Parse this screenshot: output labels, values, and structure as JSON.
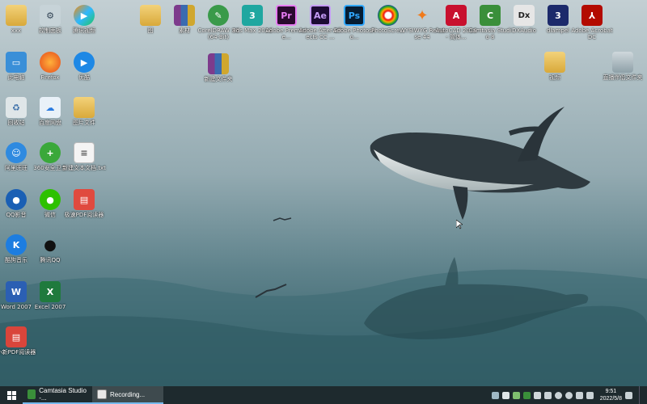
{
  "desktop_icons": {
    "left_col1": [
      {
        "label": "xxx"
      },
      {
        "label": "此电脑"
      },
      {
        "label": "回收站"
      },
      {
        "label": "阿里旺旺"
      },
      {
        "label": "QQ影音"
      },
      {
        "label": "酷狗音乐"
      },
      {
        "label": "Word 2007"
      },
      {
        "label": "小新PDF阅读器"
      }
    ],
    "left_col2": [
      {
        "label": "控制面板"
      },
      {
        "label": "Firefox"
      },
      {
        "label": "百度网盘"
      },
      {
        "label": "360安全卫士"
      },
      {
        "label": "微信"
      },
      {
        "label": "腾讯QQ"
      },
      {
        "label": "Excel 2007"
      }
    ],
    "left_col3": [
      {
        "label": "腾讯视频"
      },
      {
        "label": "优酷"
      },
      {
        "label": "图片文件"
      },
      {
        "label": "新建文本文档.txt"
      },
      {
        "label": "极速PDF阅读器"
      }
    ],
    "top_row": [
      {
        "label": "图"
      },
      {
        "label": "素材"
      },
      {
        "label": "CorelDRAW X6 (64-Bit)"
      },
      {
        "label": "3ds Max 2016"
      },
      {
        "label": "Adobe Premiere..."
      },
      {
        "label": "Adobe After Effects CC ..."
      },
      {
        "label": "Adobe Photosho..."
      },
      {
        "label": "PhotoScre..."
      },
      {
        "label": "WYSIWYG Release 44"
      },
      {
        "label": "AutoCAD 2016 - 简体..."
      },
      {
        "label": "Camtasia Studio 8"
      },
      {
        "label": "DXAudio"
      },
      {
        "label": "dlampel"
      },
      {
        "label": "Adobe Acrobat DC"
      }
    ],
    "misc": [
      {
        "label": "新建文件夹"
      },
      {
        "label": "视频"
      },
      {
        "label": "直播伴侣文件夹"
      }
    ]
  },
  "taskbar": {
    "tasks": [
      {
        "label": "Camtasia Studio -..."
      },
      {
        "label": "Recording..."
      }
    ],
    "clock": {
      "time": "9:51",
      "date": "2022/5/8"
    }
  },
  "colors": {
    "taskbar_bg": "#1e2a2e",
    "accent": "#76b9ed"
  }
}
